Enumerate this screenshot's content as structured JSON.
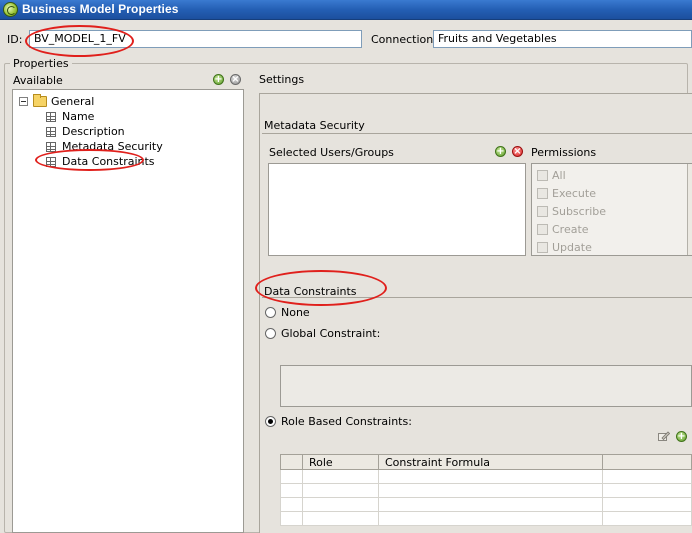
{
  "window": {
    "title": "Business Model Properties"
  },
  "id_field": {
    "label": "ID:",
    "value": "BV_MODEL_1_FV"
  },
  "connection": {
    "label": "Connection:",
    "value": "Fruits and Vegetables"
  },
  "properties": {
    "group_label": "Properties",
    "available_label": "Available",
    "tree": {
      "root": "General",
      "children": [
        "Name",
        "Description",
        "Metadata Security",
        "Data Constraints"
      ]
    }
  },
  "settings": {
    "label": "Settings",
    "metadata_security": {
      "heading": "Metadata Security",
      "users_label": "Selected Users/Groups",
      "permissions_label": "Permissions",
      "permissions": [
        "All",
        "Execute",
        "Subscribe",
        "Create",
        "Update"
      ]
    },
    "data_constraints": {
      "heading": "Data Constraints",
      "option_none": "None",
      "option_global": "Global Constraint:",
      "option_role": "Role Based Constraints:",
      "selected": "Role Based Constraints:",
      "table_headers": [
        "Role",
        "Constraint Formula"
      ]
    }
  },
  "colors": {
    "titlebar": "#245fb4",
    "annotation": "#e0201c",
    "dialog_bg": "#e6e3dd"
  }
}
